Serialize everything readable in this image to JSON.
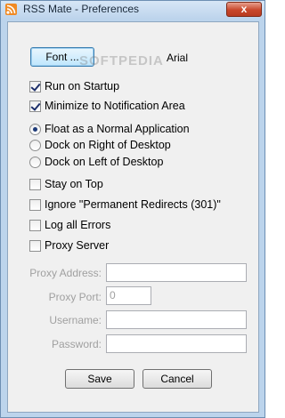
{
  "window": {
    "title": "RSS Mate - Preferences",
    "close_glyph": "x",
    "icon": "rss-icon"
  },
  "font": {
    "button_label": "Font ...",
    "value": "Arial"
  },
  "watermark": "SOFTPEDIA",
  "options": {
    "run_on_startup": {
      "label": "Run on Startup",
      "checked": true
    },
    "minimize_to_tray": {
      "label": "Minimize to Notification Area",
      "checked": true
    },
    "float_normal": {
      "label": "Float as a Normal Application",
      "selected": true
    },
    "dock_right": {
      "label": "Dock on Right of Desktop",
      "selected": false
    },
    "dock_left": {
      "label": "Dock on Left of Desktop",
      "selected": false
    },
    "stay_on_top": {
      "label": "Stay on Top",
      "checked": false
    },
    "ignore_redirects": {
      "label": "Ignore \"Permanent Redirects (301)\"",
      "checked": false
    },
    "log_errors": {
      "label": "Log all Errors",
      "checked": false
    },
    "proxy_server": {
      "label": "Proxy Server",
      "checked": false
    }
  },
  "proxy": {
    "address_label": "Proxy Address:",
    "address_value": "",
    "port_label": "Proxy Port:",
    "port_value": "0",
    "username_label": "Username:",
    "username_value": "",
    "password_label": "Password:",
    "password_value": ""
  },
  "buttons": {
    "save": "Save",
    "cancel": "Cancel"
  }
}
